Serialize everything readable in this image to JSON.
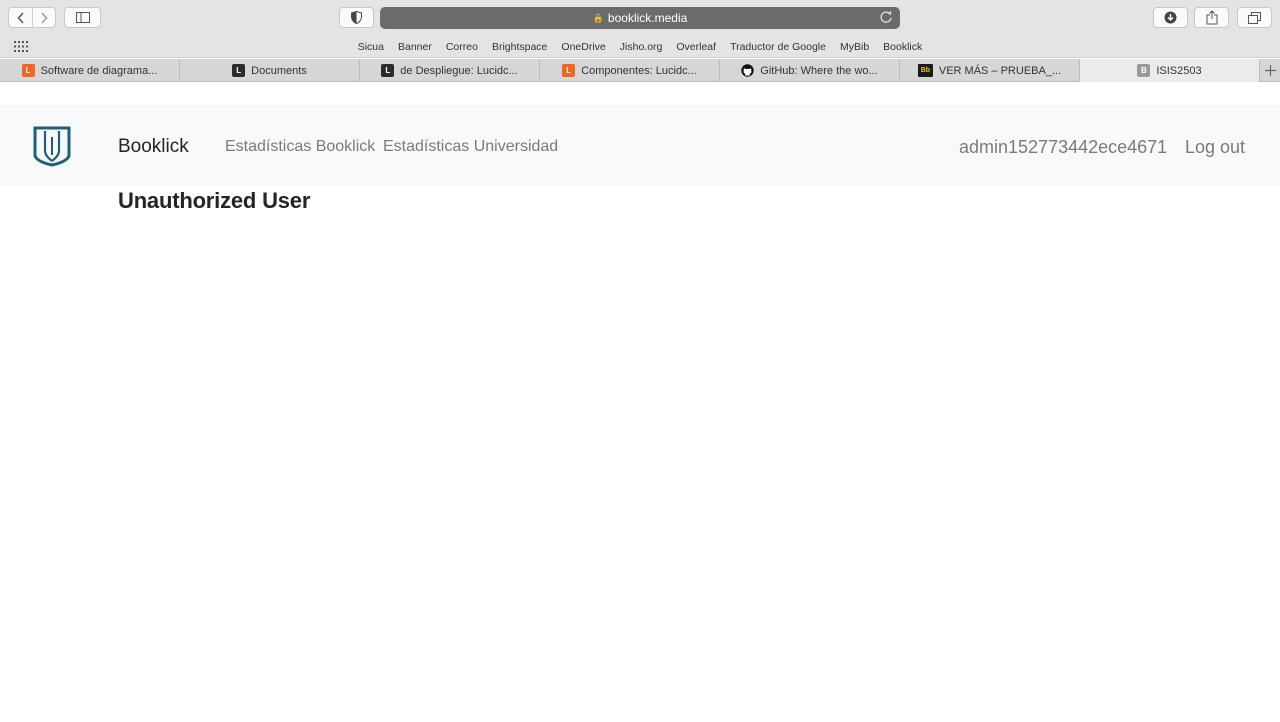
{
  "browser": {
    "url": "booklick.media",
    "favorites": [
      "Sicua",
      "Banner",
      "Correo",
      "Brightspace",
      "OneDrive",
      "Jisho.org",
      "Overleaf",
      "Traductor de Google",
      "MyBib",
      "Booklick"
    ],
    "tabs": [
      {
        "label": "Software de diagrama...",
        "icon_color": "#f26522",
        "icon": "L"
      },
      {
        "label": "Documents",
        "icon_color": "#2b2b2b",
        "icon": "L"
      },
      {
        "label": "de Despliegue: Lucidc...",
        "icon_color": "#2b2b2b",
        "icon": "L"
      },
      {
        "label": "Componentes: Lucidc...",
        "icon_color": "#f26522",
        "icon": "L"
      },
      {
        "label": "GitHub: Where the wo...",
        "icon_color": "#111111",
        "icon": "github"
      },
      {
        "label": "VER MÁS – PRUEBA_...",
        "icon_color": "#1a1a1a",
        "icon": "Bb"
      },
      {
        "label": "ISIS2503",
        "icon_color": "#9a9a9a",
        "icon": "B"
      }
    ]
  },
  "navbar": {
    "brand": "Booklick",
    "links": [
      "Estadísticas Booklick",
      "Estadísticas Universidad"
    ],
    "username": "admin152773442ece4671",
    "logout": "Log out"
  },
  "main": {
    "title": "Unauthorized User"
  },
  "colors": {
    "logo": "#1f5f78",
    "navbar_bg": "#f8f9fa"
  }
}
